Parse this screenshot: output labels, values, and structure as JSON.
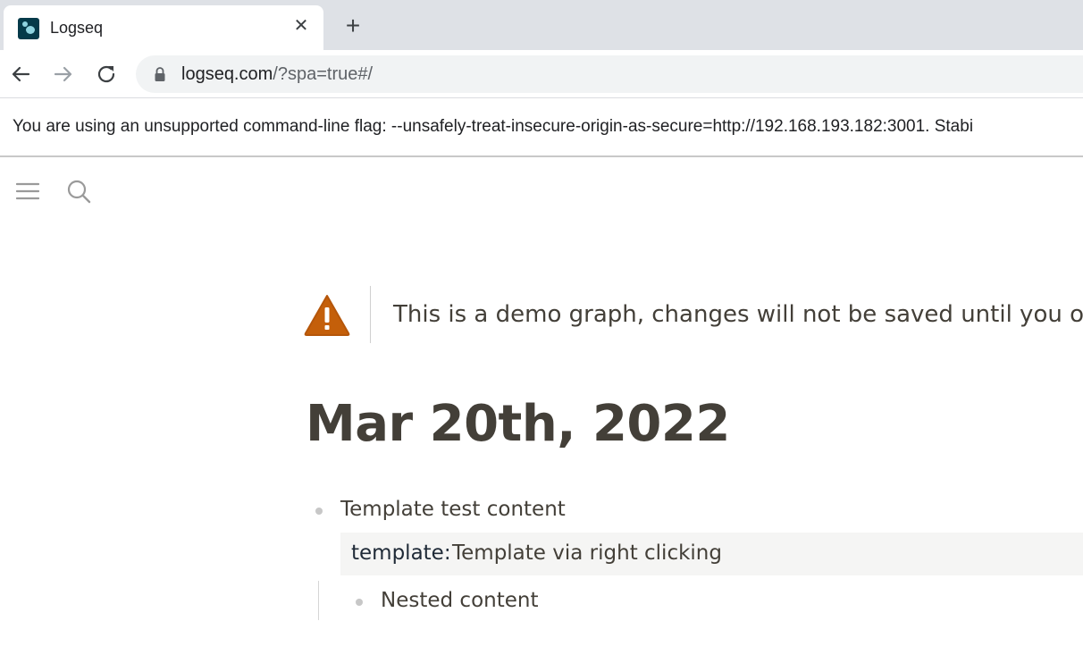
{
  "browser": {
    "tab_title": "Logseq",
    "new_tab_symbol": "+",
    "close_symbol": "✕",
    "url_host": "logseq.com",
    "url_path": "/?spa=true#/",
    "infobar_text": "You are using an unsupported command-line flag: --unsafely-treat-insecure-origin-as-secure=http://192.168.193.182:3001. Stabi"
  },
  "app": {
    "icons": [
      "menu-icon",
      "search-icon"
    ],
    "demo_warning": "This is a demo graph, changes will not be saved until you ope",
    "journal_title": "Mar 20th, 2022",
    "blocks": [
      {
        "text": "Template test content",
        "property_key": "template",
        "property_sep": ":",
        "property_value": "Template via right clicking",
        "children": [
          {
            "text": "Nested content"
          }
        ]
      }
    ]
  },
  "colors": {
    "warning_orange": "#c45f0a",
    "text": "#433f38"
  }
}
